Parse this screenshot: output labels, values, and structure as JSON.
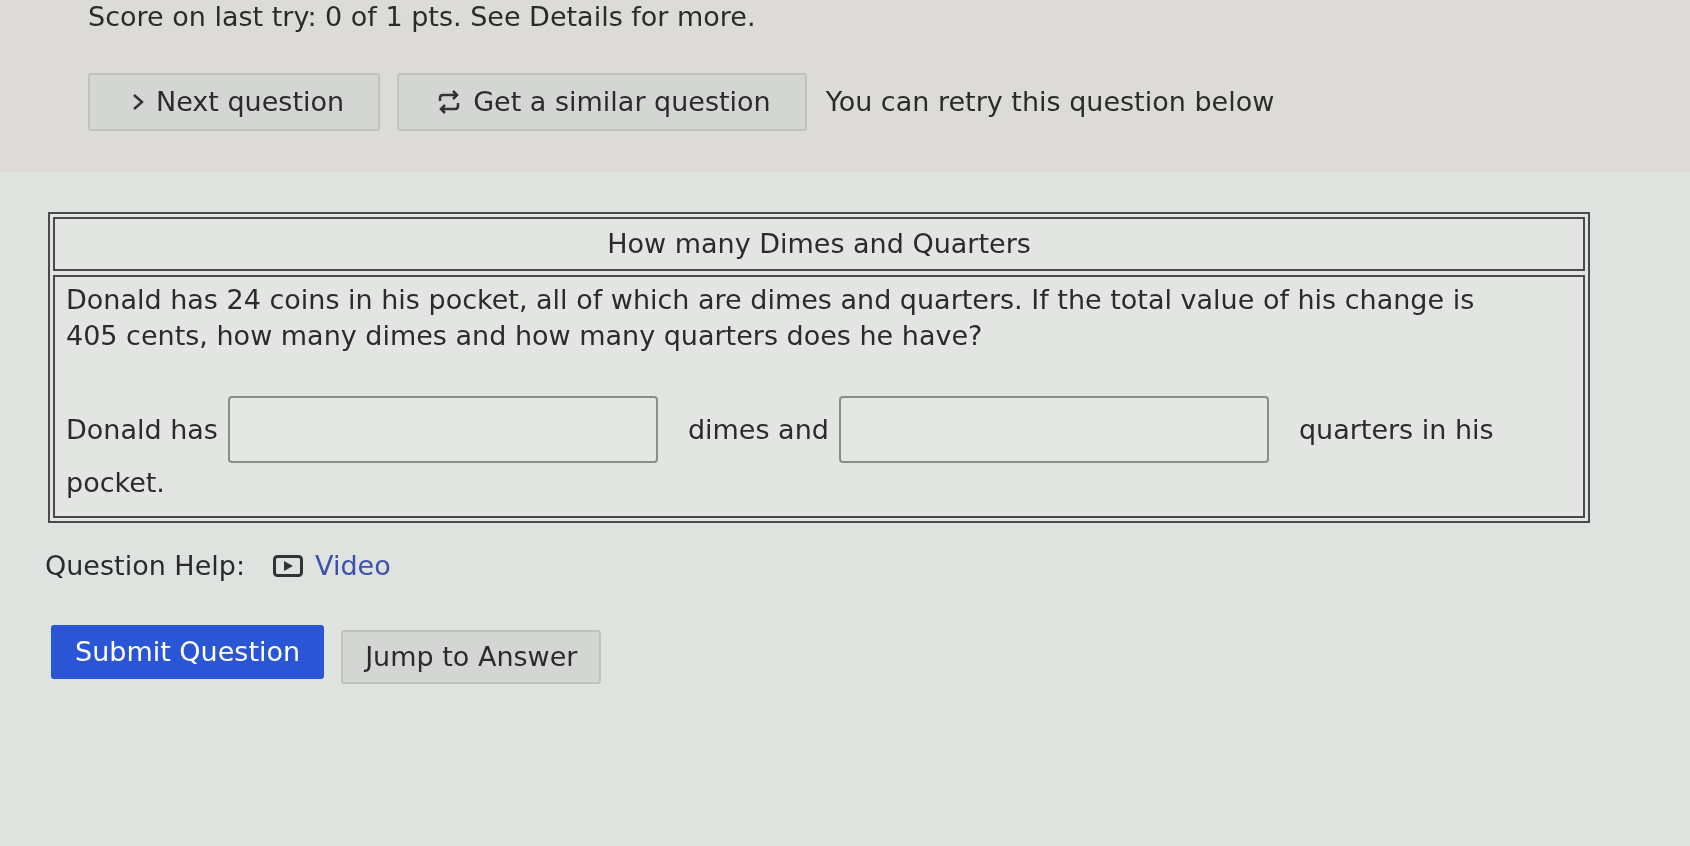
{
  "score_message": "Score on last try: 0 of 1 pts. See Details for more.",
  "actions": [
    {
      "kind": "next",
      "label": "Next question"
    },
    {
      "kind": "similar",
      "label": "Get a similar question"
    }
  ],
  "retry_note": "You can retry this question below",
  "question": {
    "title": "How many Dimes and Quarters",
    "prompt": "Donald has 24 coins in his pocket, all of which are dimes and quarters. If the total value of his change is 405 cents, how many dimes and how many quarters does he have?",
    "answer_line": [
      {
        "kind": "text",
        "text": "Donald has"
      },
      {
        "kind": "blank"
      },
      {
        "kind": "text",
        "text": "dimes and"
      },
      {
        "kind": "blank"
      },
      {
        "kind": "text",
        "text": "quarters in his"
      },
      {
        "kind": "text",
        "text": "pocket."
      }
    ]
  },
  "question_help": {
    "label": "Question Help:",
    "links": [
      {
        "kind": "video",
        "label": "Video"
      }
    ]
  },
  "buttons": [
    {
      "kind": "primary",
      "label": "Submit Question"
    },
    {
      "kind": "secondary",
      "label": "Jump to Answer"
    }
  ]
}
